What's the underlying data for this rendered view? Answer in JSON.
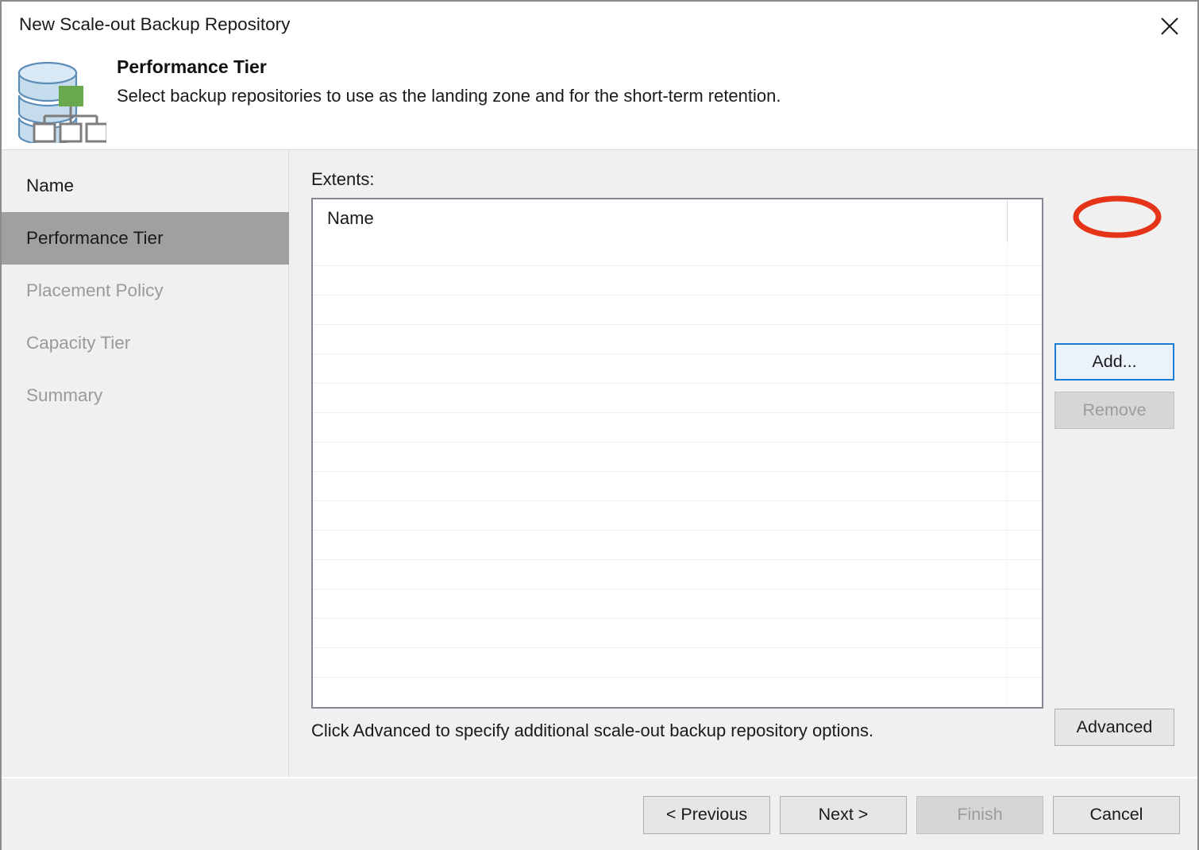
{
  "window": {
    "title": "New Scale-out Backup Repository",
    "close_icon": "close-icon"
  },
  "header": {
    "icon": "scale-out-repository-icon",
    "title": "Performance Tier",
    "subtitle": "Select backup repositories to use as the landing zone and for the short-term retention."
  },
  "sidebar": {
    "items": [
      {
        "label": "Name",
        "state": "done"
      },
      {
        "label": "Performance Tier",
        "state": "active"
      },
      {
        "label": "Placement Policy",
        "state": "todo"
      },
      {
        "label": "Capacity Tier",
        "state": "todo"
      },
      {
        "label": "Summary",
        "state": "todo"
      }
    ]
  },
  "content": {
    "extents_label": "Extents:",
    "list": {
      "columns": [
        "Name"
      ],
      "rows": []
    },
    "hint": "Click Advanced to specify additional scale-out backup repository options.",
    "add_label": "Add...",
    "remove_label": "Remove",
    "advanced_label": "Advanced"
  },
  "footer": {
    "previous_label": "< Previous",
    "next_label": "Next >",
    "finish_label": "Finish",
    "cancel_label": "Cancel"
  },
  "annotation": {
    "shape": "ellipse",
    "target": "add-button",
    "color": "#e53417"
  },
  "colors": {
    "accent_focus": "#1a7fd4",
    "active_nav_bg": "#a0a0a0",
    "body_bg": "#f0f0f0",
    "annotation_red": "#e53417",
    "icon_blue": "#b9d3ea",
    "icon_green": "#6aa84f"
  }
}
